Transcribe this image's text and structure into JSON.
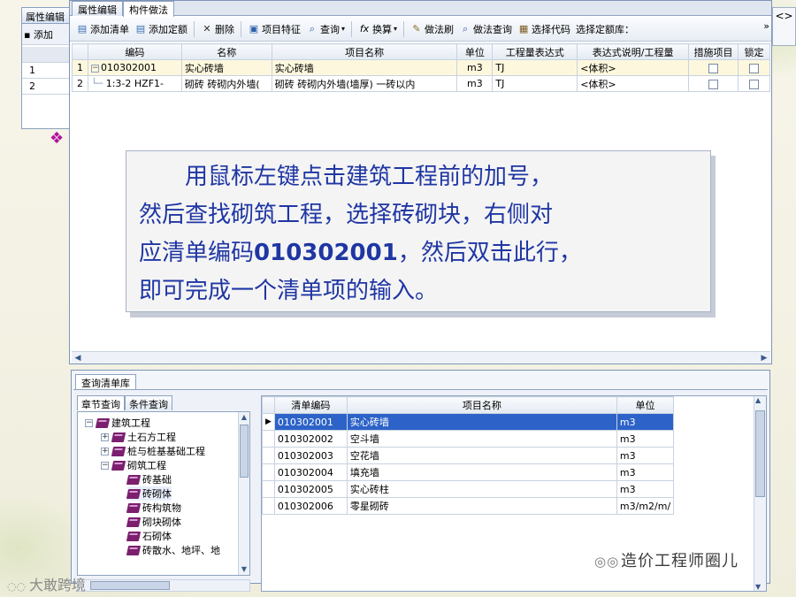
{
  "background_window": {
    "tab_label": "属性编辑",
    "toolbar_label": "添加",
    "row_numbers": [
      "1",
      "2"
    ]
  },
  "right_strip": {
    "text": "<>"
  },
  "main_window": {
    "tabs": [
      "属性编辑",
      "构件做法"
    ],
    "toolbar": {
      "add_list": "添加清单",
      "add_quota": "添加定额",
      "delete": "删除",
      "item_feature": "项目特征",
      "query": "查询",
      "convert": "换算",
      "method_brush": "做法刷",
      "method_query": "做法查询",
      "select_code": "选择代码",
      "select_quota_lib": "选择定额库：",
      "more": "»"
    },
    "columns": [
      "编码",
      "名称",
      "项目名称",
      "单位",
      "工程量表达式",
      "表达式说明/工程量",
      "措施项目",
      "锁定"
    ],
    "rows": [
      {
        "num": "1",
        "code": "010302001",
        "name": "实心砖墙",
        "project_name": "实心砖墙",
        "unit": "m3",
        "expr": "TJ",
        "expr_desc": "<体积>"
      },
      {
        "num": "2",
        "code": "1:3-2 HZF1-",
        "name": "砌砖 砖砌内外墙(",
        "project_name": "砌砖 砖砌内外墙(墙厚) 一砖以内",
        "unit": "m3",
        "expr": "TJ",
        "expr_desc": "<体积>"
      }
    ]
  },
  "callout": {
    "lines": [
      "用鼠标左键点击建筑工程前的加号，",
      "然后查找砌筑工程，选择砖砌块，右侧对",
      "应清单编码",
      "010302001",
      "，然后双击此行，",
      "即可完成一个清单项的输入。"
    ]
  },
  "bottom_panel": {
    "tab_label": "查询清单库",
    "sub_tabs": [
      "章节查询",
      "条件查询"
    ],
    "tree": [
      {
        "label": "建筑工程",
        "level": 0,
        "expander": "−"
      },
      {
        "label": "土石方工程",
        "level": 1,
        "expander": "+"
      },
      {
        "label": "桩与桩基基础工程",
        "level": 1,
        "expander": "+"
      },
      {
        "label": "砌筑工程",
        "level": 1,
        "expander": "−"
      },
      {
        "label": "砖基础",
        "level": 2,
        "expander": ""
      },
      {
        "label": "砖砌体",
        "level": 2,
        "expander": ""
      },
      {
        "label": "砖构筑物",
        "level": 2,
        "expander": ""
      },
      {
        "label": "砌块砌体",
        "level": 2,
        "expander": ""
      },
      {
        "label": "石砌体",
        "level": 2,
        "expander": ""
      },
      {
        "label": "砖散水、地坪、地",
        "level": 2,
        "expander": ""
      }
    ],
    "lib_columns": [
      "清单编码",
      "项目名称",
      "单位"
    ],
    "lib_rows": [
      {
        "code": "010302001",
        "name": "实心砖墙",
        "unit": "m3"
      },
      {
        "code": "010302002",
        "name": "空斗墙",
        "unit": "m3"
      },
      {
        "code": "010302003",
        "name": "空花墙",
        "unit": "m3"
      },
      {
        "code": "010302004",
        "name": "填充墙",
        "unit": "m3"
      },
      {
        "code": "010302005",
        "name": "实心砖柱",
        "unit": "m3"
      },
      {
        "code": "010302006",
        "name": "零星砌砖",
        "unit": "m3/m2/m/"
      }
    ]
  },
  "watermarks": {
    "right": "造价工程师圈儿",
    "left": "大敢跨境"
  }
}
